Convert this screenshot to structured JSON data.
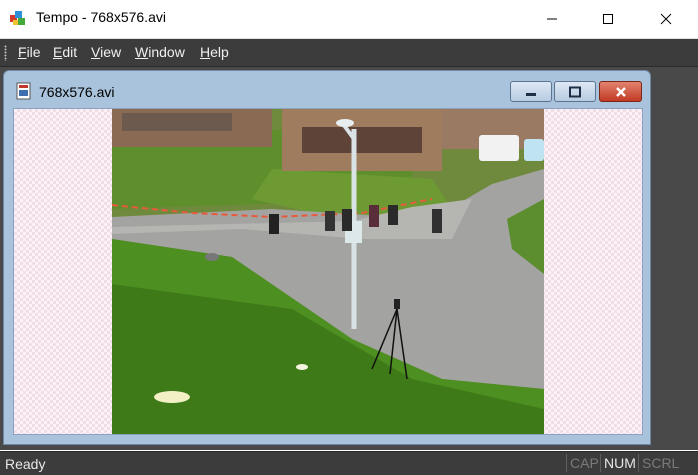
{
  "window": {
    "title": "Tempo - 768x576.avi"
  },
  "menu": [
    {
      "label": "File",
      "mnemonic": "F",
      "rest": "ile"
    },
    {
      "label": "Edit",
      "mnemonic": "E",
      "rest": "dit"
    },
    {
      "label": "View",
      "mnemonic": "V",
      "rest": "iew"
    },
    {
      "label": "Window",
      "mnemonic": "W",
      "rest": "indow"
    },
    {
      "label": "Help",
      "mnemonic": "H",
      "rest": "elp"
    }
  ],
  "document": {
    "title": "768x576.avi"
  },
  "status": {
    "text": "Ready",
    "indicators": [
      {
        "label": "CAP",
        "active": false
      },
      {
        "label": "NUM",
        "active": true
      },
      {
        "label": "SCRL",
        "active": false
      }
    ]
  },
  "colors": {
    "menubar_bg": "#3c3c3c",
    "mdi_bg": "#494949",
    "child_frame": "#aac3dc",
    "close_red": "#c23a25"
  },
  "icons": {
    "app": "tempo-app-icon",
    "document": "avi-document-icon",
    "minimize": "minimize-icon",
    "maximize": "maximize-icon",
    "close": "close-icon"
  }
}
